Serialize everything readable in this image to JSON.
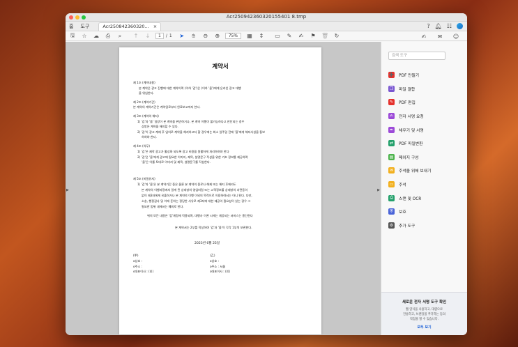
{
  "window": {
    "title": "Acr250942360320155401 8.tmp",
    "tab_home": "홈",
    "tab_tools": "도구",
    "doc_tab": "Acr250842360320...",
    "doc_tab_close": "×"
  },
  "toolbar": {
    "page_current": "1",
    "page_sep": "/",
    "page_total": "1",
    "zoom": "75%"
  },
  "sidebar": {
    "search_placeholder": "검색 도구",
    "items": [
      {
        "label": "PDF 만들기",
        "icon": "create-pdf-icon",
        "color": "#e5322d"
      },
      {
        "label": "파일 결합",
        "icon": "combine-files-icon",
        "color": "#7a57d1"
      },
      {
        "label": "PDF 편집",
        "icon": "edit-pdf-icon",
        "color": "#e5322d"
      },
      {
        "label": "전자 서명 요청",
        "icon": "request-esign-icon",
        "color": "#9c4ad8"
      },
      {
        "label": "채우기 및 서명",
        "icon": "fill-sign-icon",
        "color": "#9c4ad8"
      },
      {
        "label": "PDF 파일변환",
        "icon": "export-pdf-icon",
        "color": "#23a06b"
      },
      {
        "label": "페이지 구성",
        "icon": "organize-pages-icon",
        "color": "#4bb34b"
      },
      {
        "label": "주석을 위해 보내기",
        "icon": "send-comments-icon",
        "color": "#f2b01e"
      },
      {
        "label": "주석",
        "icon": "comment-icon",
        "color": "#f2b01e"
      },
      {
        "label": "스캔 및 OCR",
        "icon": "scan-ocr-icon",
        "color": "#23a06b"
      },
      {
        "label": "보호",
        "icon": "protect-icon",
        "color": "#4a64d8"
      },
      {
        "label": "추가 도구",
        "icon": "more-tools-icon",
        "color": "#555555"
      }
    ],
    "promo_title": "새로운 전자 서명 도구 확인",
    "promo_desc1": "웹 양식을 사용하고, 대량으로",
    "promo_desc2": "전송하고, 브랜딩을 추가하는 등의",
    "promo_desc3": "작업을 할 수 있습니다.",
    "promo_link": "모두 보기"
  },
  "document": {
    "title": "계약서",
    "lines": [
      "제 1조 (계약내용)",
      "본 계약은 광고 진행에 대한 계약이며                    (이하 '갑')은                      (이하 '을')에게 온라인 광고 대행",
      "을 위임한다.",
      "제 2조 (계약기간)",
      "본 계약의 계약기간은 계약일로부터 완료보고까지 한다.",
      "제 3조 (계약의 해지)",
      "1) '갑'과 '을' 일방이 본 계약을 위반하거나, 본 계약 이행이 불가능하다고 판단되는 경우",
      "상방은 계약을 해지할 수 있다.",
      "2) '갑'이 광고 계재 후 임의로 계약을 해지하고자 할 경우에는 최소 일주일 전에 '을'에게 해지사실을 통보",
      "하여야 한다.",
      "제 4조 (의무)",
      "1) '갑'은 제작 광고가 활성화 되도록 광고 비용을 원활하게 처리하여야 한다",
      "2) '갑'은 '을'에게 광고에 필요한 이미지, 제목, 설명문구 작성을 위한 기초 정보를 제공하며",
      "'을'은 이를 토대로 이미지 및 제목, 설명문구를 작성한다.",
      "제 5조 (비밀유지)",
      "1) '갑'과 '을'은 본 계약기간 중은 물론 본 계약의 종료나 해제 또는 해지 후에라도",
      "본 계약의 이행과정에서 알게 된 상대방의 영업비밀 또는 고객정보를 상대방의 서면동의",
      "없이 제3자에게 유출하거나 본 계약의 이행 이외의 목적으로 이용하여서는 아니 된다. 다만,",
      "소송, 행정감사 및 이에 준하는 정당한 사유로 제3자에 대한 제공의 필요성이 있는 경우 그",
      "필요한 범위 내에서는 예외로 한다.",
      "위의 모든 내용은 '갑'계정에 적용되며, 대행사 이관 시에는 계공되는 서비스는 종단한다",
      "본 계약서는 2부를 작성하여 '갑'과 '을'이 각각 1부씩 보관한다.",
      "2023년  6월  25일",
      "(甲)",
      "(乙)",
      "o상호 :",
      "o주소 :",
      "o대표이사 :                        (인)",
      "o상호 :",
      "o주소 : 서울",
      "o대표이사 :                 (인)"
    ]
  }
}
